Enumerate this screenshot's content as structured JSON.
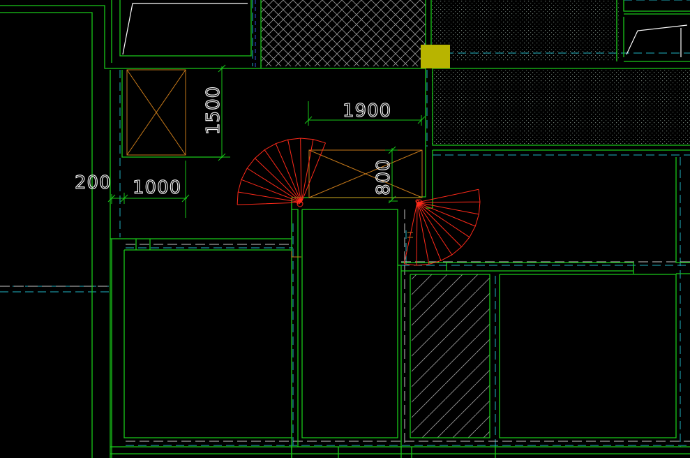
{
  "drawing": {
    "background_color": "#000000",
    "wall_color": "#19c919",
    "axis_color": "#1fb5c4",
    "door_swing_color": "#ff2a1a",
    "shaft_color": "#c87a1a",
    "grip_color": "#b8b400"
  },
  "dimensions": {
    "d1500": "1500",
    "d1900": "1900",
    "d800": "800",
    "d200": "200",
    "d1000": "1000"
  },
  "icons": {
    "selection_grip": "square-grip-icon"
  }
}
